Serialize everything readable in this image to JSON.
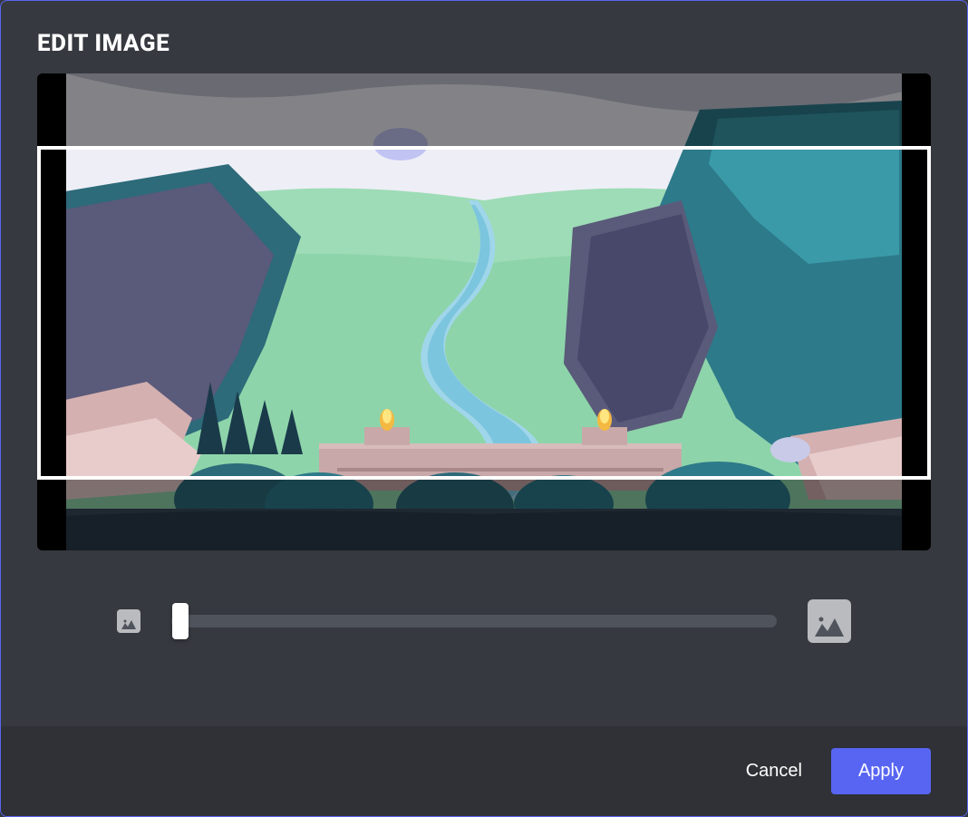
{
  "modal": {
    "title": "EDIT IMAGE"
  },
  "zoom": {
    "value": 0,
    "min": 0,
    "max": 100
  },
  "footer": {
    "cancel_label": "Cancel",
    "apply_label": "Apply"
  },
  "colors": {
    "accent": "#5865f2",
    "modal_bg": "#36393f",
    "footer_bg": "#2f3136",
    "slider_track": "#4f545c",
    "icon_bg": "#b9bbbe"
  }
}
